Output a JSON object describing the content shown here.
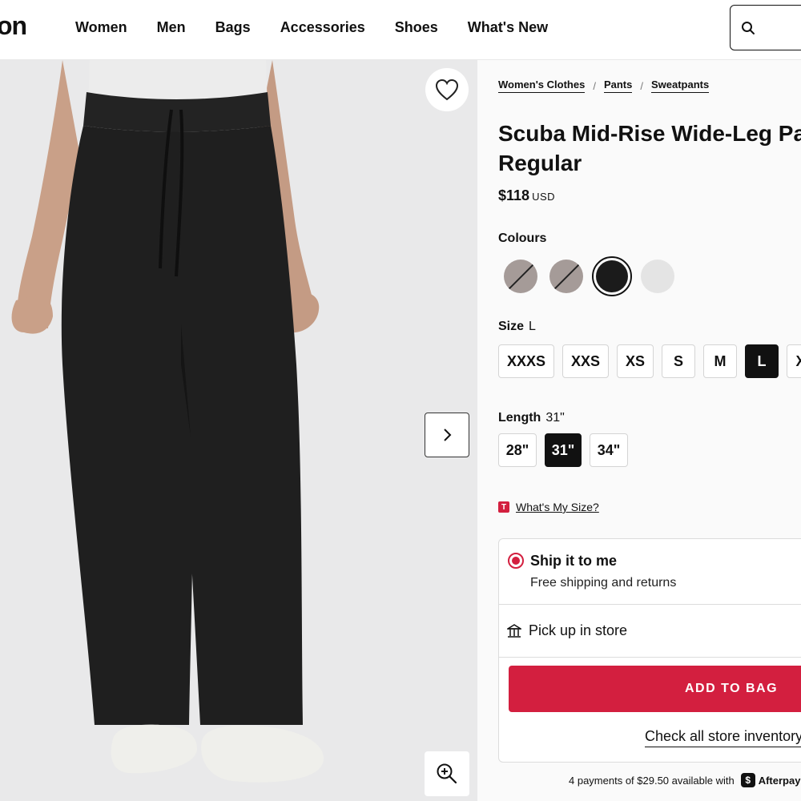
{
  "header": {
    "logo_text": "on",
    "nav": [
      "Women",
      "Men",
      "Bags",
      "Accessories",
      "Shoes",
      "What's New"
    ],
    "search_icon": "search-icon"
  },
  "media": {
    "favorite_icon": "heart-icon",
    "next_icon": "chevron-right-icon",
    "zoom_icon": "zoom-in-icon"
  },
  "breadcrumbs": [
    "Women's Clothes",
    "Pants",
    "Sweatpants"
  ],
  "product": {
    "title": "Scuba Mid-Rise Wide-Leg Pant Regular",
    "price": "$118",
    "currency": "USD"
  },
  "colours": {
    "label": "Colours",
    "swatches": [
      {
        "color": "#a59b98",
        "status": "sold-out"
      },
      {
        "color": "#a59b98",
        "status": "sold-out"
      },
      {
        "color": "#1b1b1b",
        "status": "selected"
      },
      {
        "color": "#e4e4e4",
        "status": "available"
      }
    ]
  },
  "size": {
    "label": "Size",
    "selected": "L",
    "options": [
      "XXXS",
      "XXS",
      "XS",
      "S",
      "M",
      "L",
      "XL"
    ]
  },
  "length": {
    "label": "Length",
    "selected": "31\"",
    "options": [
      "28\"",
      "31\"",
      "34\""
    ]
  },
  "whats_my_size": {
    "badge": "T",
    "label": "What's My Size?"
  },
  "fulfilment": {
    "ship_title": "Ship it to me",
    "ship_sub": "Free shipping and returns",
    "pickup_label": "Pick up in store",
    "add_to_bag": "ADD TO BAG",
    "check_inventory": "Check all store inventory"
  },
  "afterpay": {
    "text": "4 payments of $29.50 available with",
    "brand": "Afterpay"
  },
  "colors": {
    "accent": "#d31f3f",
    "image_bg": "#e9e9ea",
    "panel_bg": "#fafafa"
  }
}
